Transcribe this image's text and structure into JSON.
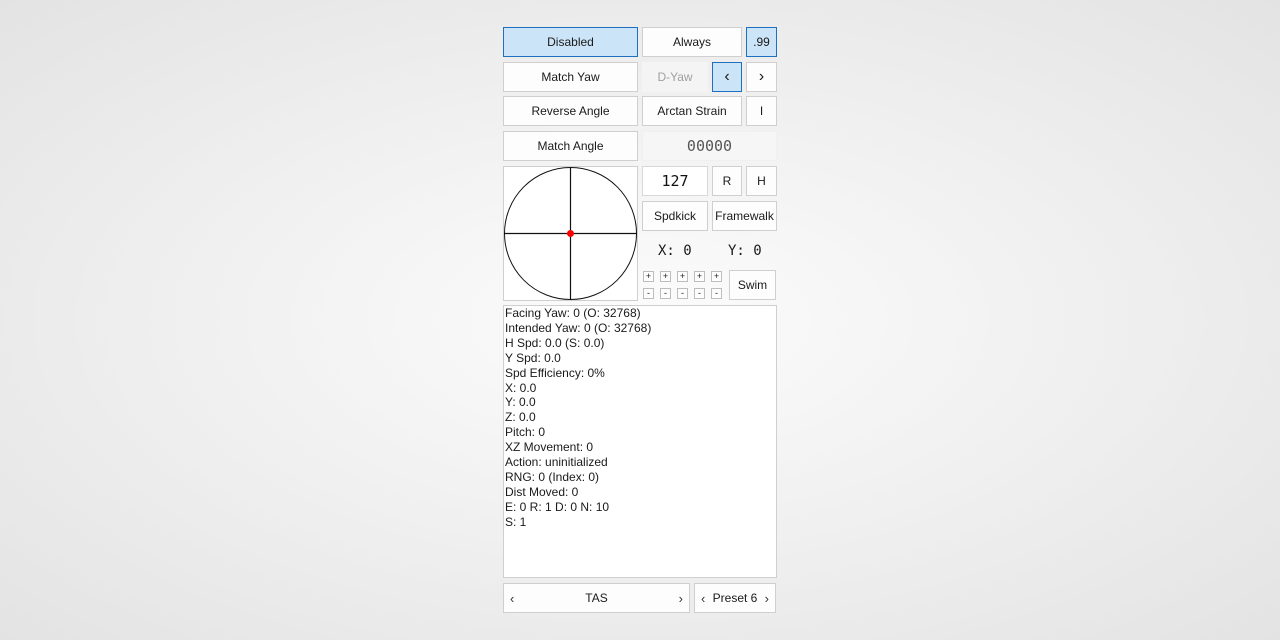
{
  "row1": {
    "disabled": "Disabled",
    "always": "Always",
    "fraction": ".99"
  },
  "row2": {
    "match_yaw": "Match Yaw",
    "d_yaw": "D-Yaw",
    "prev": "‹",
    "next": "›"
  },
  "row3": {
    "reverse_angle": "Reverse Angle",
    "arctan_strain": "Arctan Strain",
    "i": "I"
  },
  "row4": {
    "match_angle": "Match Angle",
    "angle_display": "00000"
  },
  "controls": {
    "magnitude": "127",
    "r": "R",
    "h": "H",
    "spdkick": "Spdkick",
    "framewalk": "Framewalk",
    "x_label": "X: 0",
    "y_label": "Y: 0",
    "plus": "+",
    "minus": "-",
    "swim": "Swim"
  },
  "info_lines": [
    "Facing Yaw: 0 (O: 32768)",
    "Intended Yaw: 0 (O: 32768)",
    "H Spd: 0.0 (S: 0.0)",
    "Y Spd: 0.0",
    "Spd Efficiency: 0%",
    "X: 0.0",
    "Y: 0.0",
    "Z: 0.0",
    "Pitch: 0",
    "XZ Movement: 0",
    "Action: uninitialized",
    "RNG: 0 (Index: 0)",
    "Dist Moved: 0",
    "E: 0 R: 1 D: 0 N: 10",
    "S: 1"
  ],
  "footer": {
    "mode": "TAS",
    "preset": "Preset 6",
    "left_arrow": "‹",
    "right_arrow": "›"
  },
  "colors": {
    "active_bg": "#cce4f7",
    "active_border": "#1e6fc0",
    "stick_dot": "#ff0000"
  }
}
